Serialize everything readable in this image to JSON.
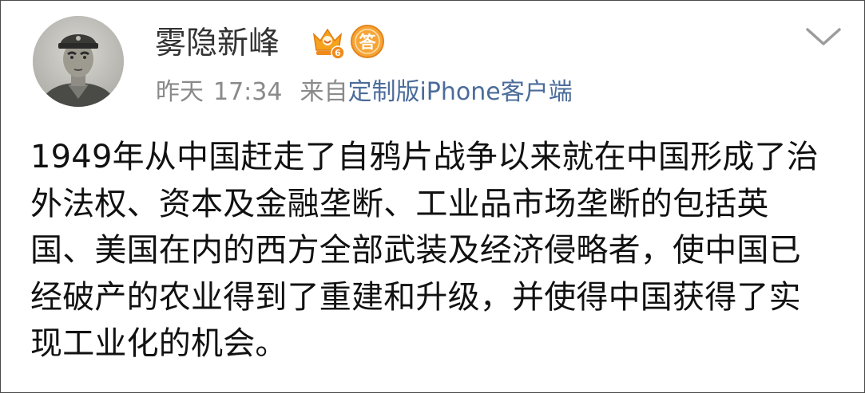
{
  "post": {
    "author": {
      "username": "雾隐新峰",
      "badges": {
        "vip": "vip-crown-badge-icon",
        "vip_level": "6",
        "answer": "答"
      }
    },
    "meta": {
      "day": "昨天",
      "time": "17:34",
      "from_label": "来自",
      "client": "定制版iPhone客户端"
    },
    "text": "1949年从中国赶走了自鸦片战争以来就在中国形成了治外法权、资本及金融垄断、工业品市场垄断的包括英国、美国在内的西方全部武装及经济侵略者，使中国已经破产的农业得到了重建和升级，并使得中国获得了实现工业化的机会。"
  },
  "colors": {
    "username": "#333333",
    "meta": "#8a8a8a",
    "client_link": "#4b6c9a",
    "badge_orange": "#f39020",
    "body_text": "#111111"
  },
  "icons": {
    "more": "chevron-down-icon"
  }
}
